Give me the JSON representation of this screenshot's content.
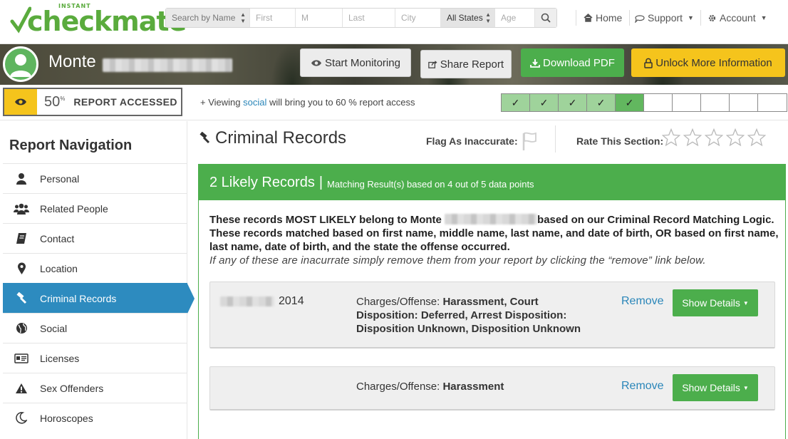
{
  "brand": {
    "small": "INSTANT",
    "name_prefix": "check",
    "name_main": "mate",
    "color": "#5aab3d"
  },
  "search": {
    "type_select": "Search by Name",
    "first_placeholder": "First",
    "middle_placeholder": "M",
    "last_placeholder": "Last",
    "city_placeholder": "City",
    "state_select": "All States",
    "age_placeholder": "Age"
  },
  "topnav": {
    "home": "Home",
    "support": "Support",
    "account": "Account"
  },
  "profile": {
    "first_name": "Monte"
  },
  "banner_buttons": {
    "monitor": "Start Monitoring",
    "share": "Share Report",
    "download": "Download PDF",
    "unlock": "Unlock More Information"
  },
  "access": {
    "percent": "50",
    "percent_sign": "%",
    "label": "REPORT ACCESSED",
    "msg_pre": "+ Viewing ",
    "msg_link": "social",
    "msg_post": " will bring you to 60 % report access",
    "steps_done": 5,
    "steps_total": 10
  },
  "sidebar": {
    "title": "Report Navigation",
    "items": [
      {
        "label": "Personal",
        "icon": "person-icon"
      },
      {
        "label": "Related People",
        "icon": "group-icon"
      },
      {
        "label": "Contact",
        "icon": "book-icon"
      },
      {
        "label": "Location",
        "icon": "map-marker-icon"
      },
      {
        "label": "Criminal Records",
        "icon": "gavel-icon",
        "active": true
      },
      {
        "label": "Social",
        "icon": "globe-icon"
      },
      {
        "label": "Licenses",
        "icon": "id-card-icon"
      },
      {
        "label": "Sex Offenders",
        "icon": "warning-icon"
      },
      {
        "label": "Horoscopes",
        "icon": "moon-icon"
      }
    ]
  },
  "section": {
    "title": "Criminal Records",
    "flag_label": "Flag As Inaccurate:",
    "rate_label": "Rate This Section:",
    "rating": 0
  },
  "panel": {
    "count": "2 Likely Records",
    "separator": "|",
    "subtitle": "Matching Result(s) based on 4 out of 5 data points",
    "desc_pre": "These records MOST LIKELY belong to Monte ",
    "desc_post": "based on our Criminal Record Matching Logic. These records matched based on first name, middle name, last name, and date of birth, OR based on first name, last name, date of birth, and the state the offense occurred.",
    "desc_italic": "If any of these are inacurrate simply remove them from your report by clicking the “remove” link below."
  },
  "records": [
    {
      "year": "2014",
      "charges_label": "Charges/Offense: ",
      "charges_value": "Harassment, Court Disposition: Deferred, Arrest Disposition: Disposition Unknown, Disposition Unknown",
      "remove": "Remove",
      "details": "Show Details"
    },
    {
      "year": "",
      "charges_label": "Charges/Offense: ",
      "charges_value": "Harassment",
      "remove": "Remove",
      "details": "Show Details"
    }
  ],
  "colors": {
    "green": "#4cae4c",
    "blue": "#2d8bbf",
    "yellow": "#f5c41c",
    "link": "#2a86b9"
  }
}
